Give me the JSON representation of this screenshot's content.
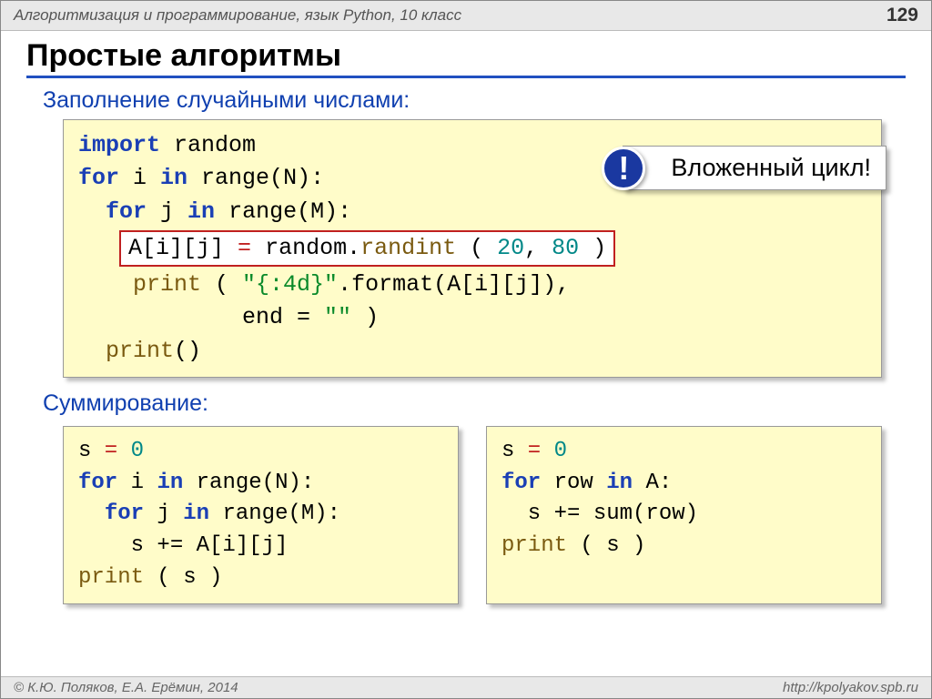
{
  "header": {
    "breadcrumb": "Алгоритмизация и программирование, язык Python, 10 класс",
    "page_number": "129"
  },
  "title": "Простые алгоритмы",
  "section1_label": "Заполнение случайными числами:",
  "code1": {
    "l1_import": "import",
    "l1_random": " random",
    "l2_for": "for",
    "l2_rest": " i ",
    "l2_in": "in",
    "l2_range": " range(N):",
    "l3_for": "for",
    "l3_rest": " j ",
    "l3_in": "in",
    "l3_range": " range(M):",
    "box_pre": "A[i][j]",
    "box_eq": " = ",
    "box_rand": "random.",
    "box_randint": "randint",
    "box_args1": " ( ",
    "box_n1": "20",
    "box_c": ", ",
    "box_n2": "80",
    "box_args2": " )",
    "l5_print": "print",
    "l5_open": " ( ",
    "l5_str": "\"{:4d}\"",
    "l5_fmt": ".format(A[i][j]),",
    "l6_pad": "            end = ",
    "l6_str": "\"\"",
    "l6_close": " )",
    "l7_print": "print",
    "l7_rest": "()"
  },
  "callout": {
    "bang": "!",
    "text": "Вложенный цикл!"
  },
  "section2_label": "Суммирование:",
  "code2": {
    "l1_s": "s",
    "l1_eq": " = ",
    "l1_zero": "0",
    "l2_for": "for",
    "l2_i": " i ",
    "l2_in": "in",
    "l2_range": " range(N):",
    "l3_for": "for",
    "l3_j": " j ",
    "l3_in": "in",
    "l3_range": " range(M):",
    "l4": "    s += A[i][j]",
    "l5_print": "print",
    "l5_rest": " ( s )"
  },
  "code3": {
    "l1_s": "s",
    "l1_eq": " = ",
    "l1_zero": "0",
    "l2_for": "for",
    "l2_row": " row ",
    "l2_in": "in",
    "l2_a": " A:",
    "l3": "  s += sum(row)",
    "l4_print": "print",
    "l4_rest": " ( s )"
  },
  "footer": {
    "left": "© К.Ю. Поляков, Е.А. Ерёмин, 2014",
    "right": "http://kpolyakov.spb.ru"
  }
}
